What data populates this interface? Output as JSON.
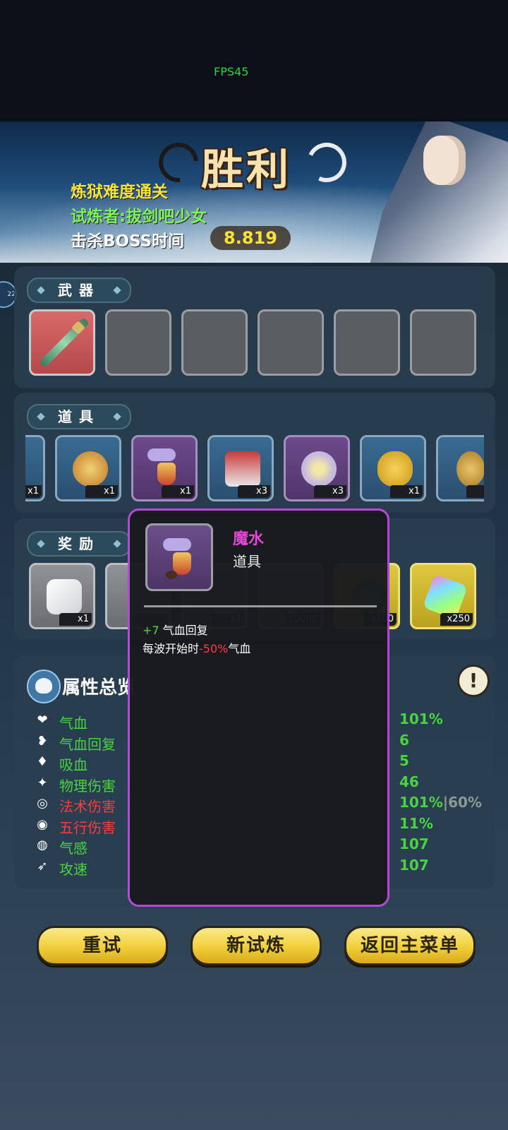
{
  "hud": {
    "fps": "FPS45"
  },
  "banner": {
    "title": "胜利",
    "difficulty": "炼狱难度通关",
    "challenger": "试炼者:拔剑吧少女",
    "boss_time_label": "击杀BOSS时间",
    "boss_time_value": "8.819"
  },
  "edge_badge": "22",
  "weapons": {
    "label": "武器",
    "slots": [
      "green-jade-sword-icon",
      "empty",
      "empty",
      "empty",
      "empty",
      "empty"
    ]
  },
  "items": {
    "label": "道具",
    "entries": [
      {
        "qty": "x1"
      },
      {
        "qty": "x1"
      },
      {
        "qty": "x1"
      },
      {
        "qty": "x3"
      },
      {
        "qty": "x3"
      },
      {
        "qty": "x1"
      },
      {
        "qty": ""
      }
    ]
  },
  "rewards": {
    "label": "奖励",
    "entries": [
      {
        "qty": "x1"
      },
      {
        "qty": ""
      },
      {
        "qty": "x4"
      },
      {
        "qty": "x5000"
      },
      {
        "qty": "x100"
      },
      {
        "qty": "x250"
      }
    ]
  },
  "attributes": {
    "title": "属性总览",
    "left": [
      {
        "icon": "heart-icon",
        "glyph": "❤",
        "label": "气血",
        "color": "#49d43f"
      },
      {
        "icon": "heart-regen-icon",
        "glyph": "❥",
        "label": "气血回复",
        "color": "#49d43f"
      },
      {
        "icon": "lifesteal-drop-icon",
        "glyph": "♦",
        "label": "吸血",
        "color": "#49d43f"
      },
      {
        "icon": "physical-damage-icon",
        "glyph": "✦",
        "label": "物理伤害",
        "color": "#49d43f"
      },
      {
        "icon": "magic-damage-icon",
        "glyph": "◎",
        "label": "法术伤害",
        "color": "#ff3b3b"
      },
      {
        "icon": "element-damage-icon",
        "glyph": "◉",
        "label": "五行伤害",
        "color": "#ff3b3b"
      },
      {
        "icon": "qi-sense-icon",
        "glyph": "◍",
        "label": "气感",
        "color": "#49d43f"
      },
      {
        "icon": "attack-speed-icon",
        "glyph": "➶",
        "label": "攻速",
        "color": "#49d43f"
      }
    ],
    "right_values": [
      "101%",
      "6",
      "5",
      "46",
      "101%",
      "11%",
      "107",
      "107"
    ],
    "right_dim": [
      "",
      "",
      "",
      "",
      "|60%",
      "",
      "",
      ""
    ]
  },
  "buttons": {
    "retry": "重试",
    "new_trial": "新试炼",
    "main_menu": "返回主菜单"
  },
  "tooltip": {
    "name": "魔水",
    "type": "道具",
    "effect1_value": "+7",
    "effect1_text": " 气血回复",
    "effect2_prefix": "每波开始时",
    "effect2_value": "-50%",
    "effect2_suffix": "气血"
  },
  "colors": {
    "tooltip_border": "#b548d8",
    "item_name": "#e347d9",
    "positive": "#58d244",
    "negative": "#ff3b3b",
    "button_gold": "#f1cf3a"
  }
}
